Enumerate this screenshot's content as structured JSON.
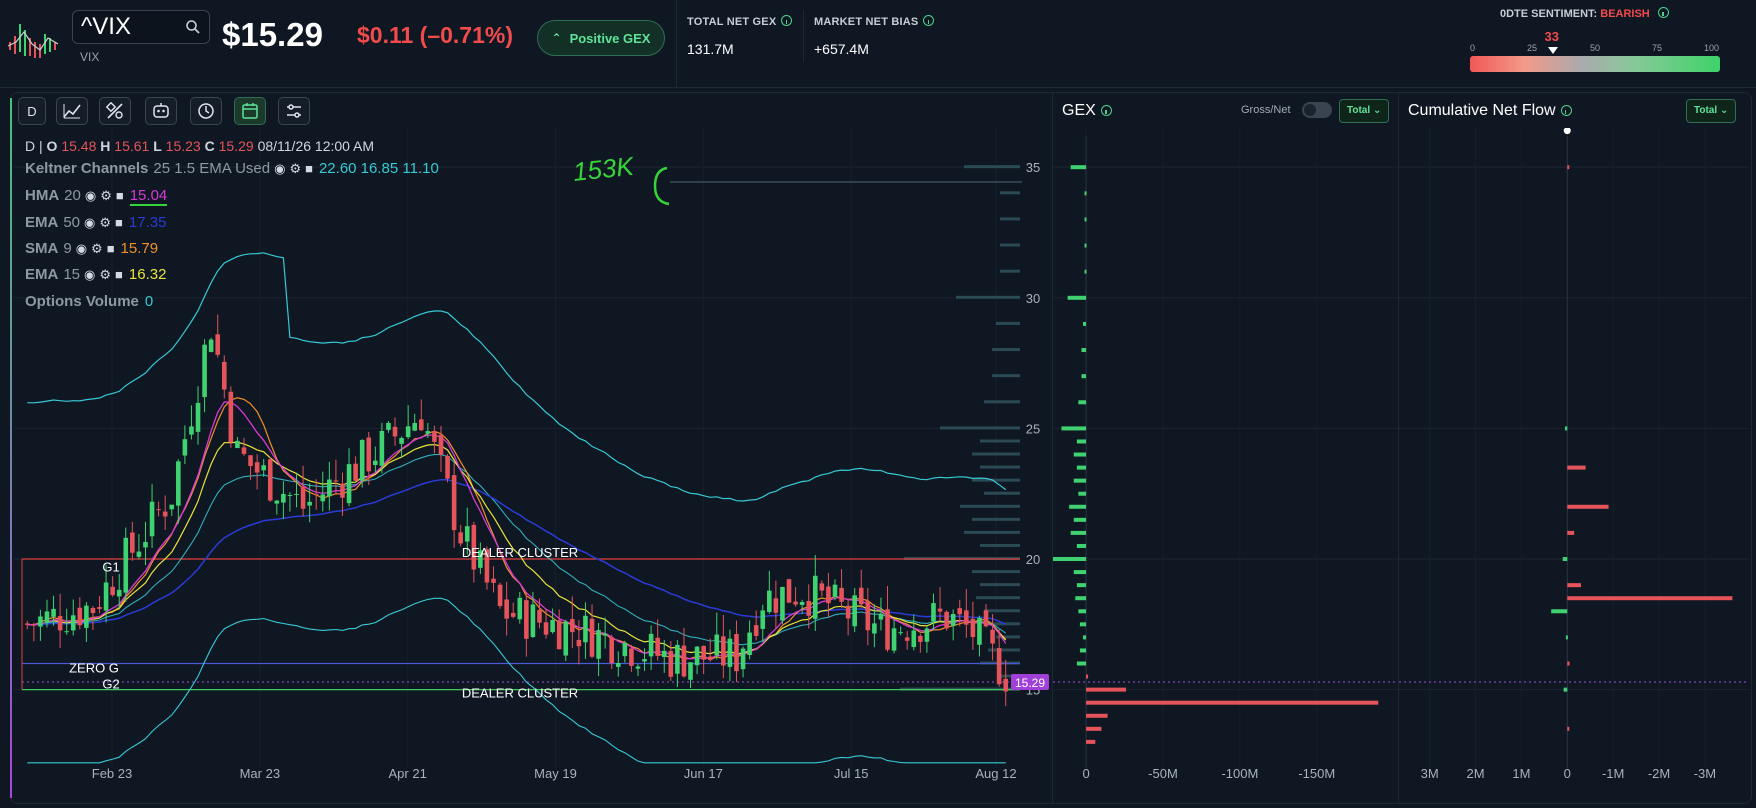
{
  "header": {
    "ticker_value": "^VIX",
    "ticker_sub": "VIX",
    "price": "$15.29",
    "change": "$0.11 (–0.71%)",
    "gex_badge": "Positive GEX",
    "total_net_gex_label": "TOTAL NET GEX",
    "total_net_gex_value": "131.7M",
    "market_net_bias_label": "MARKET NET BIAS",
    "market_net_bias_value": "+657.4M",
    "sentiment_label": "0DTE SENTIMENT:",
    "sentiment_state": "BEARISH",
    "sentiment_value": "33",
    "sentiment_ticks": [
      "0",
      "25",
      "50",
      "75",
      "100"
    ],
    "sentiment_level": 33
  },
  "toolbar": {
    "interval": "D",
    "icons": [
      "line-chart-icon",
      "drawing-tools-icon",
      "indicators-bot-icon",
      "history-icon",
      "calendar-icon",
      "settings-sliders-icon"
    ]
  },
  "legend": {
    "ohlc": {
      "interval": "D",
      "o_label": "O",
      "o": "15.48",
      "h_label": "H",
      "h": "15.61",
      "l_label": "L",
      "l": "15.23",
      "c_label": "C",
      "c": "15.29",
      "date": "08/11/26 12:00 AM"
    },
    "indicators": [
      {
        "name": "Keltner Channels",
        "params": "25 1.5 EMA Used",
        "values": "22.60 16.85 11.10",
        "color": "#37c9d6"
      },
      {
        "name": "HMA",
        "params": "20",
        "values": "15.04",
        "color": "#d63ad6"
      },
      {
        "name": "EMA",
        "params": "50",
        "values": "17.35",
        "color": "#2a3bd6"
      },
      {
        "name": "SMA",
        "params": "9",
        "values": "15.79",
        "color": "#f0902a"
      },
      {
        "name": "EMA",
        "params": "15",
        "values": "16.32",
        "color": "#e9e33a"
      },
      {
        "name": "Options Volume",
        "params": "",
        "values": "0",
        "color": "#37c9d6"
      }
    ],
    "annotation_text": "153K"
  },
  "main_chart": {
    "x_labels": [
      "Feb 23",
      "Mar 23",
      "Apr 21",
      "May 19",
      "Jun 17",
      "Jul 15",
      "Aug 12"
    ],
    "y_labels": [
      "35",
      "30",
      "25",
      "20",
      "15"
    ],
    "ylim": [
      12,
      36.5
    ],
    "last_price_tag": "15.29",
    "levels": [
      {
        "name": "DEALER CLUSTER",
        "price": 20.0,
        "color": "#e04040"
      },
      {
        "name": "ZERO G",
        "price": 16.0,
        "color": "#4a5ad6"
      },
      {
        "name": "G1",
        "price": 19.6,
        "color": "#e04040"
      },
      {
        "name": "G2",
        "price": 15.0,
        "color": "#3cc85a"
      },
      {
        "name": "DEALER CLUSTER",
        "price": 15.0,
        "color": "#3cc85a"
      }
    ],
    "current_price": 15.29
  },
  "gex_panel": {
    "title": "GEX",
    "toggle_label": "Gross/Net",
    "dropdown": "Total",
    "x_labels": [
      "0",
      "-50M",
      "-100M",
      "-150M"
    ],
    "xlim": [
      15,
      -195
    ],
    "bars": [
      {
        "strike": 35,
        "value": 10
      },
      {
        "strike": 34,
        "value": 1
      },
      {
        "strike": 33,
        "value": 1
      },
      {
        "strike": 32,
        "value": 1
      },
      {
        "strike": 31,
        "value": 1
      },
      {
        "strike": 30,
        "value": 12
      },
      {
        "strike": 29,
        "value": 2
      },
      {
        "strike": 28,
        "value": 3
      },
      {
        "strike": 27,
        "value": 3
      },
      {
        "strike": 26,
        "value": 5
      },
      {
        "strike": 25,
        "value": 16
      },
      {
        "strike": 24.5,
        "value": 6
      },
      {
        "strike": 24,
        "value": 8
      },
      {
        "strike": 23.5,
        "value": 6
      },
      {
        "strike": 23,
        "value": 8
      },
      {
        "strike": 22.5,
        "value": 5
      },
      {
        "strike": 22,
        "value": 11
      },
      {
        "strike": 21.5,
        "value": 8
      },
      {
        "strike": 21,
        "value": 10
      },
      {
        "strike": 20.5,
        "value": 6
      },
      {
        "strike": 20,
        "value": 25
      },
      {
        "strike": 19.5,
        "value": 8
      },
      {
        "strike": 19,
        "value": 6
      },
      {
        "strike": 18.5,
        "value": 7
      },
      {
        "strike": 18,
        "value": 5
      },
      {
        "strike": 17.5,
        "value": 4
      },
      {
        "strike": 17,
        "value": 2
      },
      {
        "strike": 16.5,
        "value": 4
      },
      {
        "strike": 16,
        "value": 6
      },
      {
        "strike": 15.5,
        "value": -1
      },
      {
        "strike": 15,
        "value": -26
      },
      {
        "strike": 14.5,
        "value": -190
      },
      {
        "strike": 14,
        "value": -14
      },
      {
        "strike": 13.5,
        "value": -10
      },
      {
        "strike": 13,
        "value": -6
      }
    ]
  },
  "flow_panel": {
    "title": "Cumulative Net Flow",
    "dropdown": "Total",
    "x_labels": [
      "3M",
      "2M",
      "1M",
      "0",
      "-1M",
      "-2M",
      "-3M"
    ],
    "xlim": [
      3.45,
      -3.7
    ],
    "bars": [
      {
        "strike": 35,
        "value": -0.02
      },
      {
        "strike": 25,
        "value": 0.05
      },
      {
        "strike": 23.5,
        "value": -0.4
      },
      {
        "strike": 22,
        "value": -0.9
      },
      {
        "strike": 21,
        "value": -0.15
      },
      {
        "strike": 20,
        "value": 0.1
      },
      {
        "strike": 19,
        "value": -0.3
      },
      {
        "strike": 18.5,
        "value": -3.6
      },
      {
        "strike": 18,
        "value": 0.35
      },
      {
        "strike": 17,
        "value": 0.03
      },
      {
        "strike": 16,
        "value": -0.05
      },
      {
        "strike": 15,
        "value": 0.08
      },
      {
        "strike": 13.5,
        "value": -0.02
      }
    ]
  },
  "colors": {
    "up": "#3fd271",
    "down": "#e5535b",
    "accent": "#5ee39a",
    "bg": "#0f1722"
  }
}
